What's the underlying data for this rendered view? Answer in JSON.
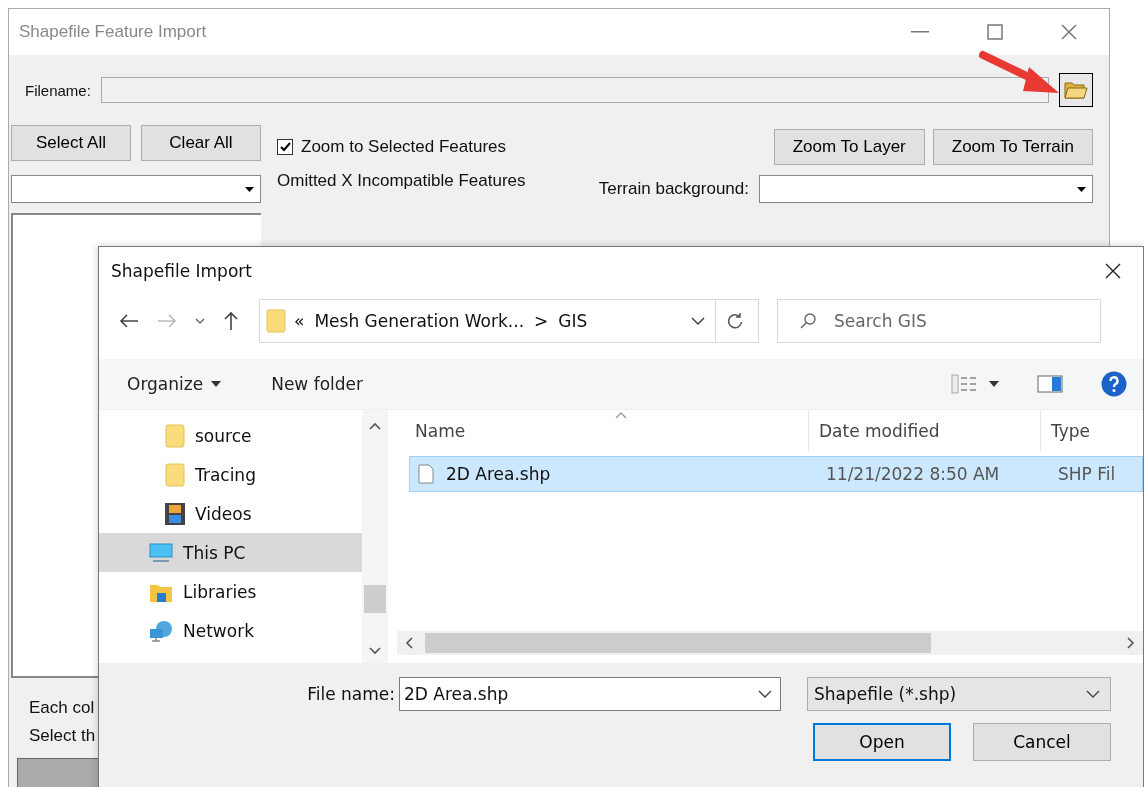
{
  "main_window": {
    "title": "Shapefile Feature Import",
    "filename_label": "Filename:",
    "select_all": "Select All",
    "clear_all": "Clear All",
    "zoom_checkbox": {
      "label": "Zoom to Selected Features",
      "checked": true
    },
    "omitted_text": "Omitted X Incompatible Features",
    "zoom_layer": "Zoom To Layer",
    "zoom_terrain": "Zoom To Terrain",
    "terrain_label": "Terrain background:",
    "bottom_lines": [
      "Each col",
      "Select th"
    ]
  },
  "dialog": {
    "title": "Shapefile Import",
    "path": [
      "Mesh Generation Work...",
      "GIS"
    ],
    "path_prefix": "«",
    "path_sep": ">",
    "search": {
      "placeholder": "Search GIS"
    },
    "organize": "Organize",
    "new_folder": "New folder",
    "nav_items": [
      {
        "label": "source",
        "kind": "folder",
        "selected": false
      },
      {
        "label": "Tracing",
        "kind": "folder",
        "selected": false
      },
      {
        "label": "Videos",
        "kind": "videos",
        "selected": false
      },
      {
        "label": "This PC",
        "kind": "computer",
        "selected": true
      },
      {
        "label": "Libraries",
        "kind": "libraries",
        "selected": false
      },
      {
        "label": "Network",
        "kind": "network",
        "selected": false
      }
    ],
    "columns": [
      "Name",
      "Date modified",
      "Type"
    ],
    "rows": [
      {
        "name": "2D Area.shp",
        "date": "11/21/2022 8:50 AM",
        "type": "SHP Fil",
        "selected": true
      }
    ],
    "file_name_label": "File name:",
    "file_name": "2D Area.shp",
    "filter": "Shapefile (*.shp)",
    "open": "Open",
    "cancel": "Cancel"
  }
}
